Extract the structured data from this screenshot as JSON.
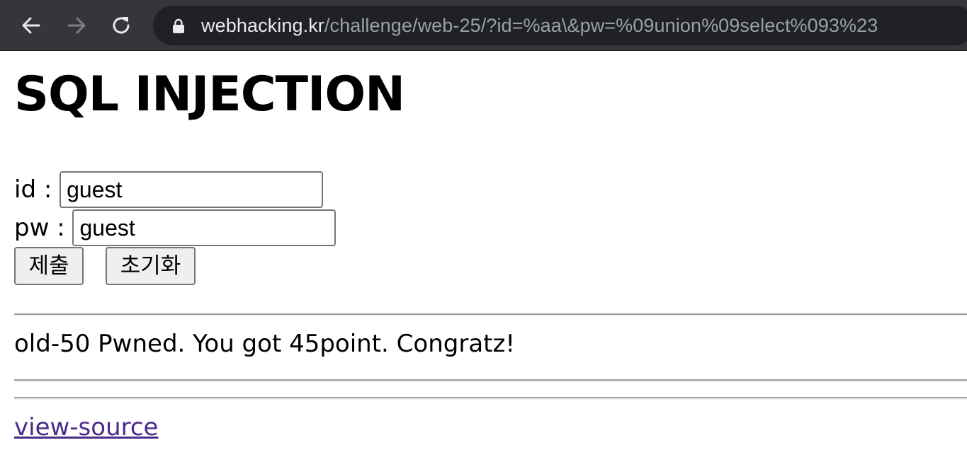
{
  "browser": {
    "url_host": "webhacking.kr",
    "url_path": "/challenge/web-25/?id=%aa\\&pw=%09union%09select%093%23",
    "icons": [
      "back-arrow-icon",
      "forward-arrow-icon",
      "reload-icon",
      "lock-icon"
    ],
    "colors": {
      "toolbar": "#35363a",
      "omnibox": "#202124",
      "host_text": "#e8eaed",
      "path_text": "#9aa0a6"
    }
  },
  "page": {
    "title": "SQL INJECTION",
    "form": {
      "id_label": "id : ",
      "id_value": "guest",
      "pw_label": "pw : ",
      "pw_value": "guest",
      "submit_label": "제출",
      "reset_label": "초기화"
    },
    "message": "old-50 Pwned. You got 45point. Congratz!",
    "link_text": "view-source",
    "colors": {
      "link": "#4c2a8a"
    }
  }
}
